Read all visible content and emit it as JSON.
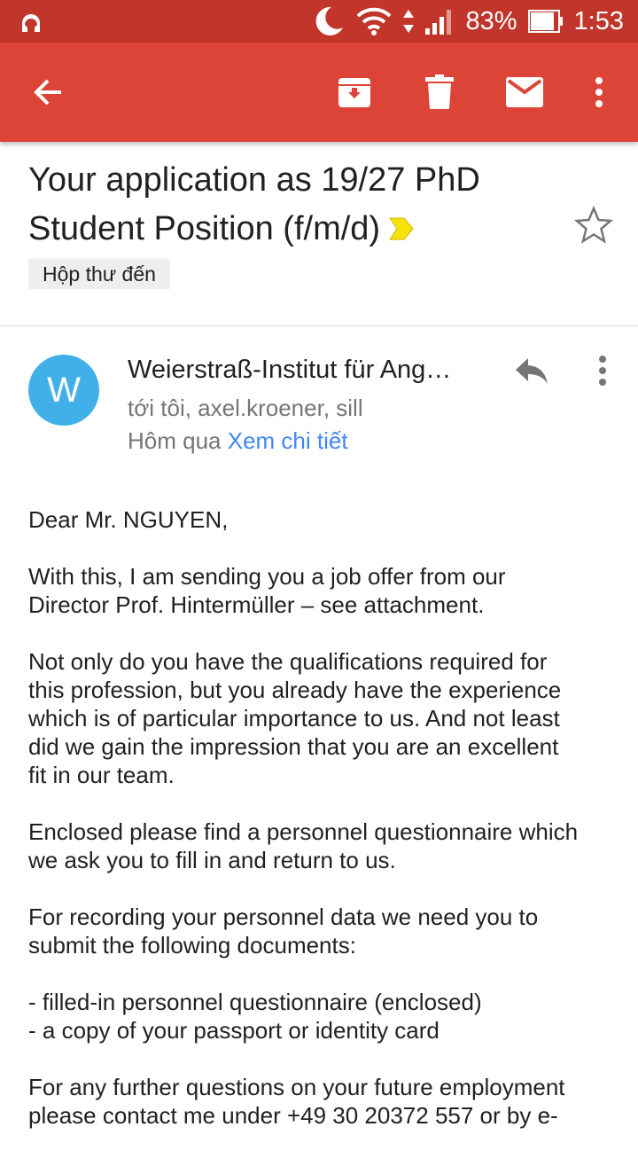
{
  "status_bar": {
    "battery": "83%",
    "time": "1:53"
  },
  "toolbar": {
    "icons": [
      "back-arrow-icon",
      "archive-icon",
      "delete-icon",
      "mark-unread-icon",
      "more-vert-icon"
    ]
  },
  "email": {
    "subject_line1": "Your application as 19/27 PhD",
    "subject_line2": "Student Position (f/m/d)",
    "label": "Hộp thư đến",
    "avatar_letter": "W",
    "sender": "Weierstraß-Institut für Ang…",
    "recipients": "tới tôi, axel.kroener, sill",
    "date": "Hôm qua",
    "details_link": "Xem chi tiết",
    "body": {
      "greeting": "Dear Mr. NGUYEN,",
      "p1_l1": "With this, I am sending you a job offer from our",
      "p1_l2": "Director Prof. Hintermüller – see attachment.",
      "p2_l1": "Not only do you have the qualifications required for",
      "p2_l2": "this profession, but you already have the experience",
      "p2_l3": "which is of particular importance to us. And not least",
      "p2_l4": "did we gain the impression that you are an excellent",
      "p2_l5": "fit in our team.",
      "p3_l1": "Enclosed please find a personnel questionnaire which",
      "p3_l2": "we ask you to fill in and return to us.",
      "p4_l1": "For recording your personnel data we need you to",
      "p4_l2": "submit the following documents:",
      "li1": "- filled-in personnel questionnaire (enclosed)",
      "li2": "- a copy of your passport or identity card",
      "p5_l1": "For any further questions on your future employment",
      "p5_l2": "please contact me under +49 30 20372 557 or by e-"
    }
  }
}
